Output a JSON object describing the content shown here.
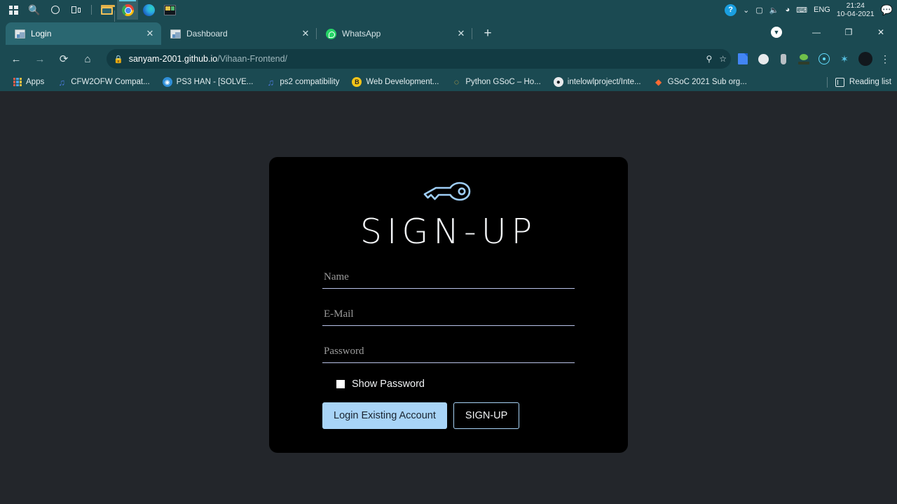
{
  "taskbar": {
    "start_label": "Start",
    "buttons": [
      {
        "name": "start-button",
        "icon": "windows-logo-icon"
      },
      {
        "name": "search-button",
        "icon": "search-icon"
      },
      {
        "name": "cortana-button",
        "icon": "circle-icon"
      },
      {
        "name": "task-view-button",
        "icon": "task-view-icon"
      },
      {
        "name": "file-explorer-button",
        "icon": "folder-icon"
      },
      {
        "name": "chrome-button",
        "icon": "chrome-icon"
      },
      {
        "name": "edge-button",
        "icon": "edge-icon"
      },
      {
        "name": "app-button",
        "icon": "app-icon"
      }
    ],
    "tray": {
      "help_icon": "?",
      "chevron": "∨",
      "meet_icon": "camera-icon",
      "volume_icon": "🔊",
      "wifi_icon": "wifi-icon",
      "keyboard_icon": "keyboard-icon",
      "language": "ENG",
      "time": "21:24",
      "date": "10-04-2021",
      "notification_icon": "notification-icon"
    }
  },
  "browser": {
    "tabs": [
      {
        "label": "Login",
        "favicon": "page-image-icon",
        "active": true
      },
      {
        "label": "Dashboard",
        "favicon": "page-image-icon",
        "active": false
      },
      {
        "label": "WhatsApp",
        "favicon": "whatsapp-icon",
        "active": false
      }
    ],
    "new_tab_glyph": "+",
    "window_controls": {
      "update_badge": "⌄",
      "minimize": "—",
      "maximize": "❐",
      "close": "✕"
    },
    "toolbar": {
      "back": "←",
      "forward": "→",
      "reload": "⟳",
      "home": "⌂",
      "lock_icon": "🔒",
      "url_domain": "sanyam-2001.github.io",
      "url_path": "/Vihaan-Frontend/",
      "url_full": "sanyam-2001.github.io/Vihaan-Frontend/",
      "key_icon": "⚷",
      "star_icon": "☆",
      "kebab_icon": "⋮",
      "extensions": [
        {
          "name": "google-docs-extension-icon"
        },
        {
          "name": "face-extension-icon"
        },
        {
          "name": "pin-extension-icon"
        },
        {
          "name": "tree-extension-icon"
        },
        {
          "name": "react-devtools-extension-icon"
        },
        {
          "name": "puzzle-extensions-icon",
          "glyph": "❖"
        }
      ],
      "avatar": "profile-avatar"
    },
    "bookmarks": [
      {
        "label": "Apps",
        "icon": "apps-grid-icon"
      },
      {
        "label": "CFW2OFW Compat...",
        "icon": "playstation-icon",
        "glyph": "♪"
      },
      {
        "label": "PS3 HAN - [SOLVE...",
        "icon": "globe-icon",
        "glyph": "⊕"
      },
      {
        "label": "ps2 compatibility",
        "icon": "playstation-icon",
        "glyph": "♪"
      },
      {
        "label": "Web Development...",
        "icon": "badge-icon",
        "glyph": "B"
      },
      {
        "label": "Python GSoC – Ho...",
        "icon": "python-icon",
        "glyph": "◔"
      },
      {
        "label": "intelowlproject/Inte...",
        "icon": "github-icon",
        "glyph": "●"
      },
      {
        "label": "GSoC 2021 Sub org...",
        "icon": "firefox-icon",
        "glyph": "◆"
      }
    ],
    "reading_list": {
      "label": "Reading list",
      "icon": "reading-list-icon"
    }
  },
  "page": {
    "title": "SIGN-UP",
    "logo_icon": "key-icon",
    "fields": [
      {
        "name": "name-input",
        "placeholder": "Name",
        "value": "",
        "type": "text"
      },
      {
        "name": "email-input",
        "placeholder": "E-Mail",
        "value": "",
        "type": "text"
      },
      {
        "name": "password-input",
        "placeholder": "Password",
        "value": "",
        "type": "password"
      }
    ],
    "checkbox": {
      "label": "Show Password",
      "checked": false
    },
    "buttons": {
      "login_label": "Login Existing Account",
      "signup_label": "SIGN-UP"
    },
    "colors": {
      "page_bg": "#23262b",
      "card_bg": "#000000",
      "accent": "#a8d4f7",
      "underline": "#b8c2e8",
      "title_text": "#f2f4f6",
      "placeholder": "#9a9a9a",
      "browser_chrome": "#1b4a52"
    }
  }
}
